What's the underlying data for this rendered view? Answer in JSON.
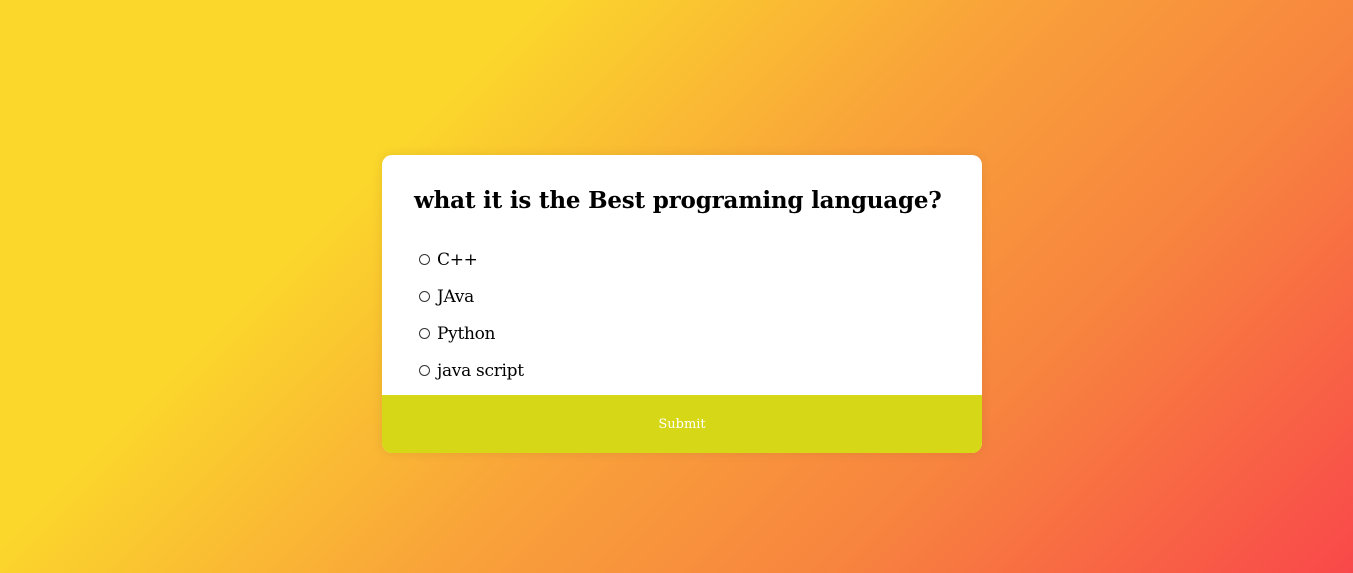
{
  "quiz": {
    "question": "what it is the Best programing language?",
    "options": [
      {
        "label": "C++",
        "selected": false
      },
      {
        "label": "JAva",
        "selected": false
      },
      {
        "label": "Python",
        "selected": false
      },
      {
        "label": "java script",
        "selected": false
      }
    ],
    "submit_label": "Submit"
  },
  "colors": {
    "background_gradient": [
      "#fbd72b",
      "#f9a33a",
      "#f7823f",
      "#f9484a"
    ],
    "card": "#ffffff",
    "submit_button": "#d6d716",
    "submit_text": "#ffffff"
  }
}
